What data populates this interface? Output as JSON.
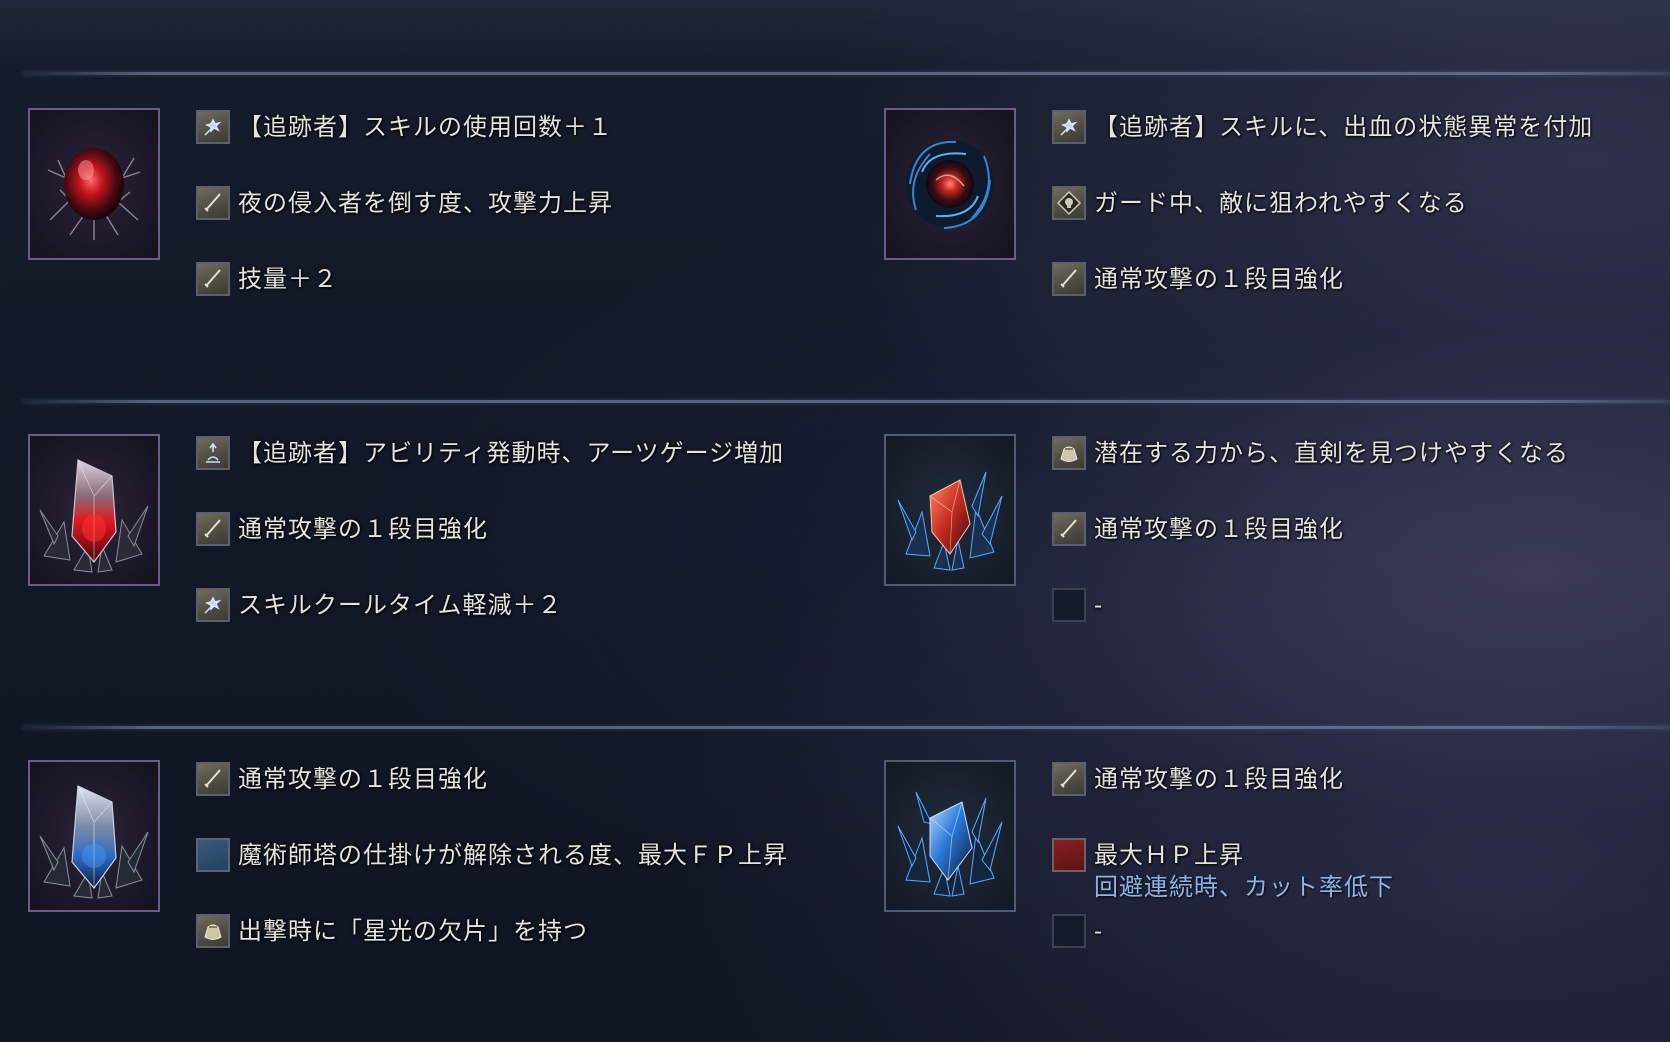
{
  "relics": [
    {
      "gem": "red-egg-relic",
      "effects": [
        {
          "icon": "skill-icon",
          "text": "【追跡者】スキルの使用回数＋１"
        },
        {
          "icon": "sword-icon",
          "text": "夜の侵入者を倒す度、攻撃力上昇"
        },
        {
          "icon": "sword-icon",
          "text": "技量＋２"
        }
      ]
    },
    {
      "gem": "red-swirl-blue-relic",
      "effects": [
        {
          "icon": "skill-icon",
          "text": "【追跡者】スキルに、出血の状態異常を付加"
        },
        {
          "icon": "shield-skull-icon",
          "text": "ガード中、敵に狙われやすくなる"
        },
        {
          "icon": "sword-icon",
          "text": "通常攻撃の１段目強化"
        }
      ]
    },
    {
      "gem": "red-crystal-relic",
      "effects": [
        {
          "icon": "ability-icon",
          "text": "【追跡者】アビリティ発動時、アーツゲージ増加"
        },
        {
          "icon": "sword-icon",
          "text": "通常攻撃の１段目強化"
        },
        {
          "icon": "skill-icon",
          "text": "スキルクールタイム軽減＋２"
        }
      ]
    },
    {
      "gem": "blue-red-crystal-relic",
      "effects": [
        {
          "icon": "pouch-icon",
          "text": "潜在する力から、直剣を見つけやすくなる"
        },
        {
          "icon": "sword-icon",
          "text": "通常攻撃の１段目強化"
        },
        {
          "icon": "empty-slot-icon",
          "text": "-"
        }
      ]
    },
    {
      "gem": "blue-crystal-relic",
      "effects": [
        {
          "icon": "sword-icon",
          "text": "通常攻撃の１段目強化"
        },
        {
          "icon": "blue-square-icon",
          "text": "魔術師塔の仕掛けが解除される度、最大ＦＰ上昇"
        },
        {
          "icon": "pouch-icon",
          "text": "出撃時に「星光の欠片」を持つ"
        }
      ]
    },
    {
      "gem": "blue-crystal-cluster-relic",
      "effects": [
        {
          "icon": "sword-icon",
          "text": "通常攻撃の１段目強化"
        },
        {
          "icon": "red-square-icon",
          "text": "最大ＨＰ上昇",
          "sub": "回避連続時、カット率低下"
        },
        {
          "icon": "empty-slot-icon",
          "text": "-"
        }
      ]
    }
  ],
  "colors": {
    "text": "#e4e3de",
    "curse_text": "#8fb3e8",
    "frame_purple": "#6d5b8d"
  }
}
